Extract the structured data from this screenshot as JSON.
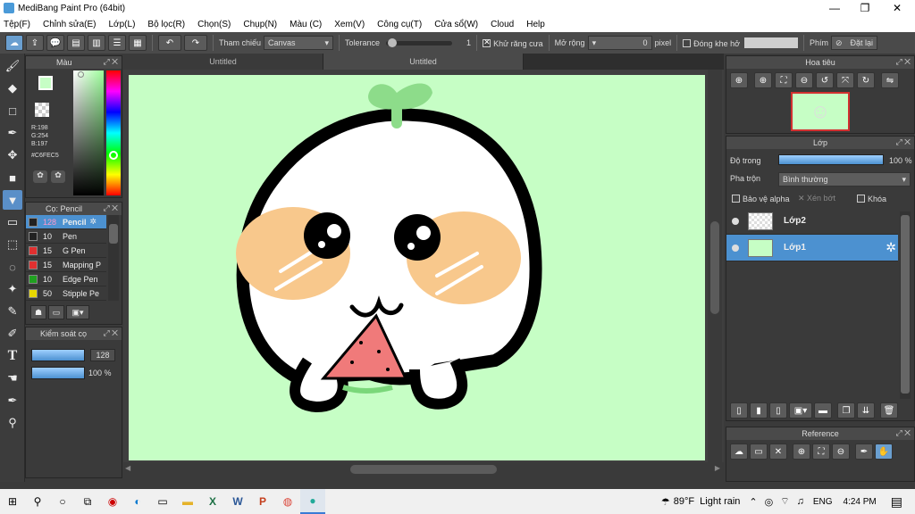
{
  "window": {
    "title": "MediBang Paint Pro (64bit)",
    "minimize": "—",
    "maximize": "❐",
    "close": "✕"
  },
  "menu": [
    "Tệp(F)",
    "Chỉnh sửa(E)",
    "Lớp(L)",
    "Bộ lọc(R)",
    "Chọn(S)",
    "Chụp(N)",
    "Màu (C)",
    "Xem(V)",
    "Công cụ(T)",
    "Cửa sổ(W)",
    "Cloud",
    "Help"
  ],
  "toolbar": {
    "reference_label": "Tham chiếu",
    "reference_value": "Canvas",
    "tolerance_label": "Tolerance",
    "tolerance_value": "1",
    "tolerance_level": 0.02,
    "antialias_label": "Khử răng cưa",
    "expand_label": "Mở rộng",
    "expand_value": "0",
    "expand_unit": "pixel",
    "close_gap_label": "Đóng khe hở",
    "key_label": "Phím",
    "reset_label": "Đặt lại"
  },
  "color_panel": {
    "title": "Màu",
    "r": "R:198",
    "g": "G:254",
    "b": "B:197",
    "hex": "#C6FEC5",
    "primary_color": "#c6fec5",
    "secondary_color": "#5a1fa8"
  },
  "brush_panel": {
    "title": "Cọ: Pencil",
    "brushes": [
      {
        "size": "128",
        "name": "Pencil",
        "color": "#222222"
      },
      {
        "size": "10",
        "name": "Pen",
        "color": "#222222"
      },
      {
        "size": "15",
        "name": "G Pen",
        "color": "#e03030"
      },
      {
        "size": "15",
        "name": "Mapping P",
        "color": "#e03030"
      },
      {
        "size": "10",
        "name": "Edge Pen",
        "color": "#20a020"
      },
      {
        "size": "50",
        "name": "Stipple Pe",
        "color": "#e8d800"
      }
    ]
  },
  "brush_control": {
    "title": "Kiểm soát cọ",
    "size_value": "128",
    "opacity_value": "100 %",
    "size_level": 1.0,
    "opacity_level": 1.0
  },
  "tabs": [
    "Untitled",
    "Untitled"
  ],
  "navigator": {
    "title": "Hoa tiêu"
  },
  "layers": {
    "title": "Lớp",
    "opacity_label": "Độ trong",
    "opacity_value": "100 %",
    "opacity_level": 1.0,
    "blend_label": "Pha trộn",
    "blend_value": "Bình thường",
    "protect_alpha": "Bảo vệ alpha",
    "clipping": "Xén bớt",
    "lock": "Khóa",
    "items": [
      {
        "name": "Lớp2",
        "selected": false
      },
      {
        "name": "Lớp1",
        "selected": true
      }
    ]
  },
  "reference": {
    "title": "Reference"
  },
  "taskbar": {
    "weather_temp": "89°F",
    "weather_text": "Light rain",
    "lang": "ENG",
    "time": "4:24 PM"
  },
  "colors": {
    "canvas_bg": "#c6fec5",
    "accent": "#4c91d0"
  }
}
